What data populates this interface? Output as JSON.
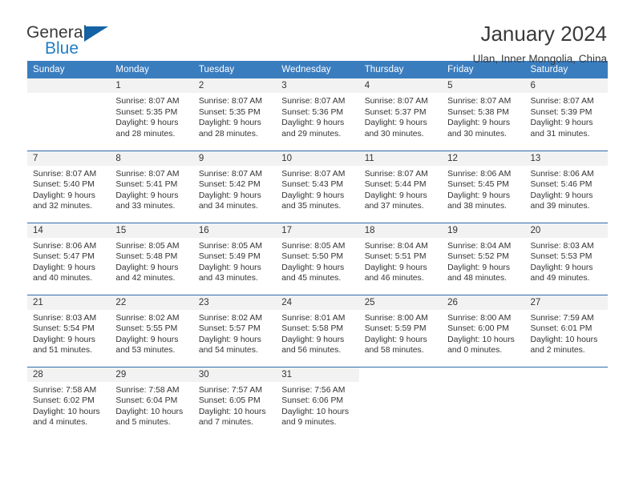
{
  "brand": {
    "name_primary": "General",
    "name_secondary": "Blue",
    "triangle_color": "#1362a4",
    "blue_color": "#1f7fc4"
  },
  "header": {
    "title": "January 2024",
    "location": "Ulan, Inner Mongolia, China"
  },
  "theme": {
    "header_row_bg": "#3a7dbf",
    "week_divider": "#2f6ca8",
    "daynum_bg": "#f2f2f2",
    "text": "#333333"
  },
  "weekday_headers": [
    "Sunday",
    "Monday",
    "Tuesday",
    "Wednesday",
    "Thursday",
    "Friday",
    "Saturday"
  ],
  "weeks": [
    [
      {
        "day": "",
        "lines": []
      },
      {
        "day": "1",
        "lines": [
          "Sunrise: 8:07 AM",
          "Sunset: 5:35 PM",
          "Daylight: 9 hours",
          "and 28 minutes."
        ]
      },
      {
        "day": "2",
        "lines": [
          "Sunrise: 8:07 AM",
          "Sunset: 5:35 PM",
          "Daylight: 9 hours",
          "and 28 minutes."
        ]
      },
      {
        "day": "3",
        "lines": [
          "Sunrise: 8:07 AM",
          "Sunset: 5:36 PM",
          "Daylight: 9 hours",
          "and 29 minutes."
        ]
      },
      {
        "day": "4",
        "lines": [
          "Sunrise: 8:07 AM",
          "Sunset: 5:37 PM",
          "Daylight: 9 hours",
          "and 30 minutes."
        ]
      },
      {
        "day": "5",
        "lines": [
          "Sunrise: 8:07 AM",
          "Sunset: 5:38 PM",
          "Daylight: 9 hours",
          "and 30 minutes."
        ]
      },
      {
        "day": "6",
        "lines": [
          "Sunrise: 8:07 AM",
          "Sunset: 5:39 PM",
          "Daylight: 9 hours",
          "and 31 minutes."
        ]
      }
    ],
    [
      {
        "day": "7",
        "lines": [
          "Sunrise: 8:07 AM",
          "Sunset: 5:40 PM",
          "Daylight: 9 hours",
          "and 32 minutes."
        ]
      },
      {
        "day": "8",
        "lines": [
          "Sunrise: 8:07 AM",
          "Sunset: 5:41 PM",
          "Daylight: 9 hours",
          "and 33 minutes."
        ]
      },
      {
        "day": "9",
        "lines": [
          "Sunrise: 8:07 AM",
          "Sunset: 5:42 PM",
          "Daylight: 9 hours",
          "and 34 minutes."
        ]
      },
      {
        "day": "10",
        "lines": [
          "Sunrise: 8:07 AM",
          "Sunset: 5:43 PM",
          "Daylight: 9 hours",
          "and 35 minutes."
        ]
      },
      {
        "day": "11",
        "lines": [
          "Sunrise: 8:07 AM",
          "Sunset: 5:44 PM",
          "Daylight: 9 hours",
          "and 37 minutes."
        ]
      },
      {
        "day": "12",
        "lines": [
          "Sunrise: 8:06 AM",
          "Sunset: 5:45 PM",
          "Daylight: 9 hours",
          "and 38 minutes."
        ]
      },
      {
        "day": "13",
        "lines": [
          "Sunrise: 8:06 AM",
          "Sunset: 5:46 PM",
          "Daylight: 9 hours",
          "and 39 minutes."
        ]
      }
    ],
    [
      {
        "day": "14",
        "lines": [
          "Sunrise: 8:06 AM",
          "Sunset: 5:47 PM",
          "Daylight: 9 hours",
          "and 40 minutes."
        ]
      },
      {
        "day": "15",
        "lines": [
          "Sunrise: 8:05 AM",
          "Sunset: 5:48 PM",
          "Daylight: 9 hours",
          "and 42 minutes."
        ]
      },
      {
        "day": "16",
        "lines": [
          "Sunrise: 8:05 AM",
          "Sunset: 5:49 PM",
          "Daylight: 9 hours",
          "and 43 minutes."
        ]
      },
      {
        "day": "17",
        "lines": [
          "Sunrise: 8:05 AM",
          "Sunset: 5:50 PM",
          "Daylight: 9 hours",
          "and 45 minutes."
        ]
      },
      {
        "day": "18",
        "lines": [
          "Sunrise: 8:04 AM",
          "Sunset: 5:51 PM",
          "Daylight: 9 hours",
          "and 46 minutes."
        ]
      },
      {
        "day": "19",
        "lines": [
          "Sunrise: 8:04 AM",
          "Sunset: 5:52 PM",
          "Daylight: 9 hours",
          "and 48 minutes."
        ]
      },
      {
        "day": "20",
        "lines": [
          "Sunrise: 8:03 AM",
          "Sunset: 5:53 PM",
          "Daylight: 9 hours",
          "and 49 minutes."
        ]
      }
    ],
    [
      {
        "day": "21",
        "lines": [
          "Sunrise: 8:03 AM",
          "Sunset: 5:54 PM",
          "Daylight: 9 hours",
          "and 51 minutes."
        ]
      },
      {
        "day": "22",
        "lines": [
          "Sunrise: 8:02 AM",
          "Sunset: 5:55 PM",
          "Daylight: 9 hours",
          "and 53 minutes."
        ]
      },
      {
        "day": "23",
        "lines": [
          "Sunrise: 8:02 AM",
          "Sunset: 5:57 PM",
          "Daylight: 9 hours",
          "and 54 minutes."
        ]
      },
      {
        "day": "24",
        "lines": [
          "Sunrise: 8:01 AM",
          "Sunset: 5:58 PM",
          "Daylight: 9 hours",
          "and 56 minutes."
        ]
      },
      {
        "day": "25",
        "lines": [
          "Sunrise: 8:00 AM",
          "Sunset: 5:59 PM",
          "Daylight: 9 hours",
          "and 58 minutes."
        ]
      },
      {
        "day": "26",
        "lines": [
          "Sunrise: 8:00 AM",
          "Sunset: 6:00 PM",
          "Daylight: 10 hours",
          "and 0 minutes."
        ]
      },
      {
        "day": "27",
        "lines": [
          "Sunrise: 7:59 AM",
          "Sunset: 6:01 PM",
          "Daylight: 10 hours",
          "and 2 minutes."
        ]
      }
    ],
    [
      {
        "day": "28",
        "lines": [
          "Sunrise: 7:58 AM",
          "Sunset: 6:02 PM",
          "Daylight: 10 hours",
          "and 4 minutes."
        ]
      },
      {
        "day": "29",
        "lines": [
          "Sunrise: 7:58 AM",
          "Sunset: 6:04 PM",
          "Daylight: 10 hours",
          "and 5 minutes."
        ]
      },
      {
        "day": "30",
        "lines": [
          "Sunrise: 7:57 AM",
          "Sunset: 6:05 PM",
          "Daylight: 10 hours",
          "and 7 minutes."
        ]
      },
      {
        "day": "31",
        "lines": [
          "Sunrise: 7:56 AM",
          "Sunset: 6:06 PM",
          "Daylight: 10 hours",
          "and 9 minutes."
        ]
      },
      {
        "day": "",
        "lines": []
      },
      {
        "day": "",
        "lines": []
      },
      {
        "day": "",
        "lines": []
      }
    ]
  ]
}
